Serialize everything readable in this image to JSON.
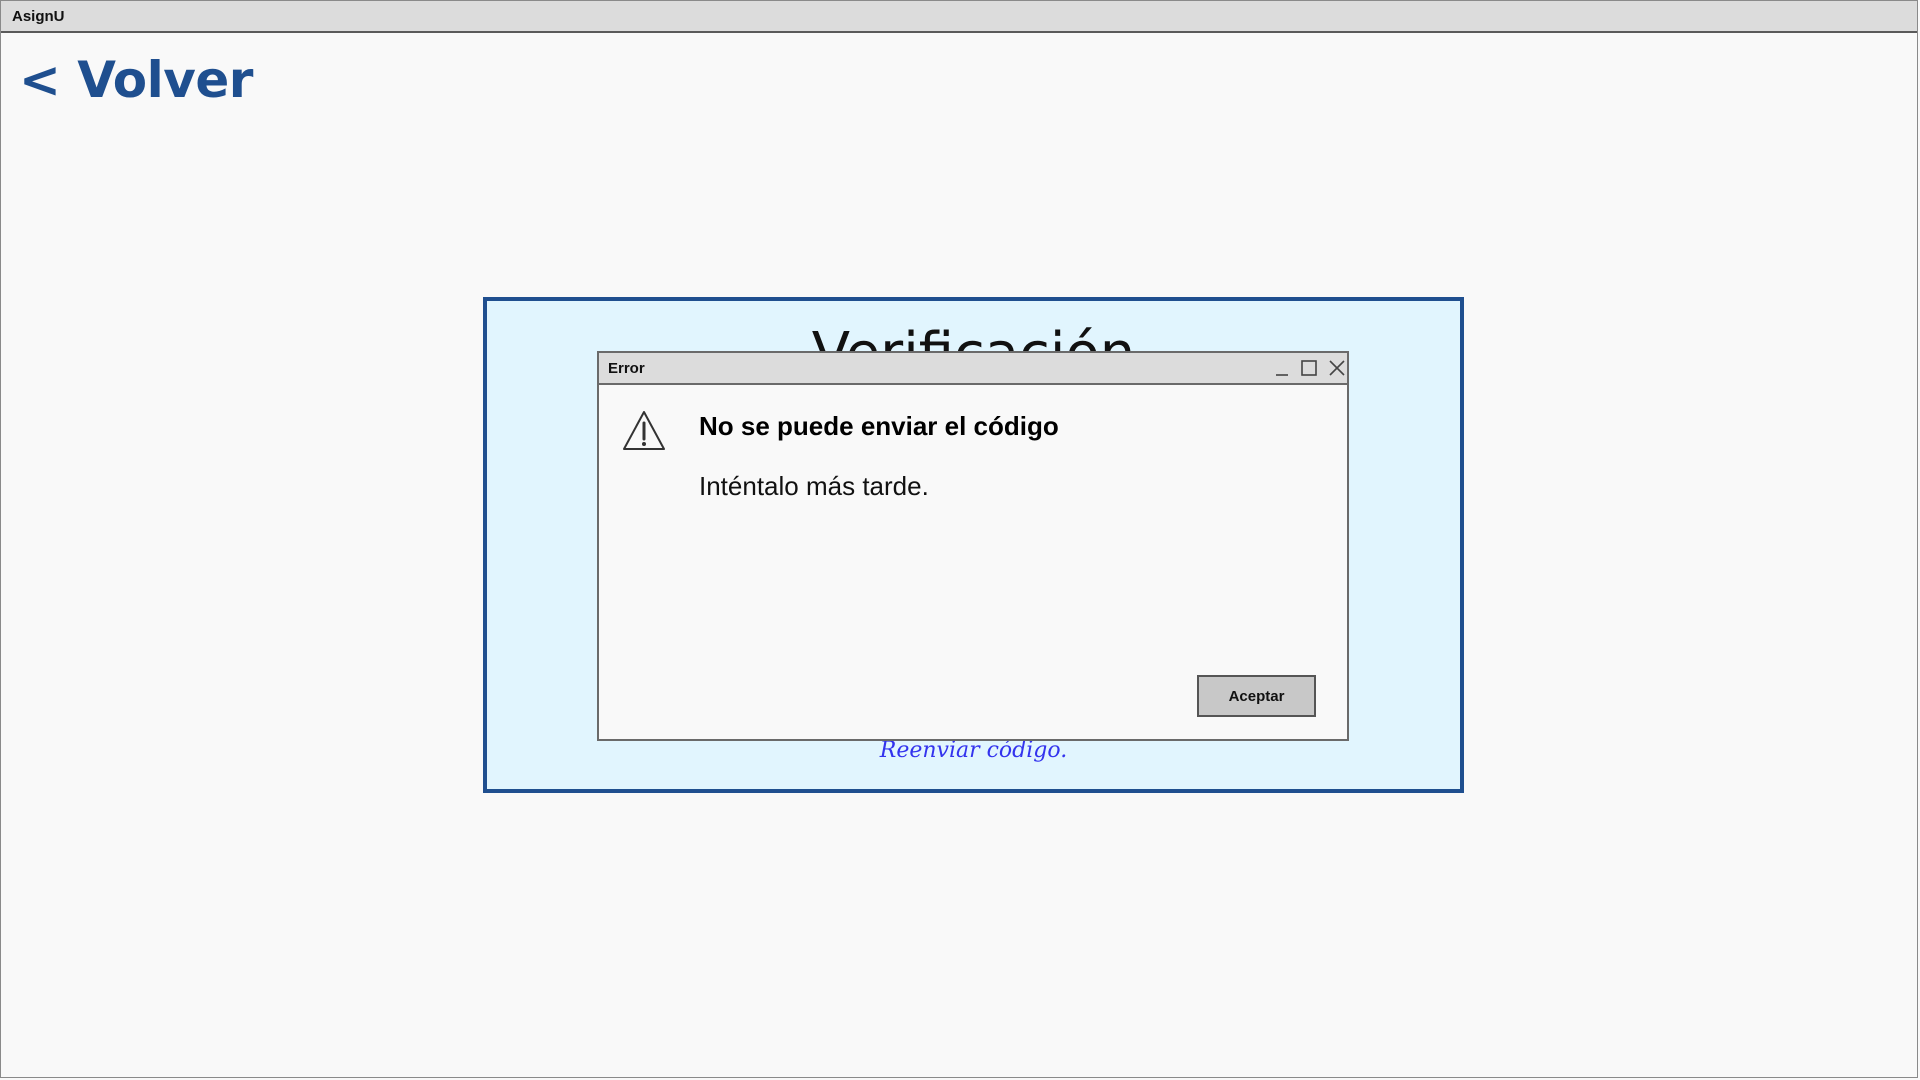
{
  "app": {
    "title": "AsignU"
  },
  "nav": {
    "back_label": "< Volver"
  },
  "verification_card": {
    "title": "Verificación",
    "resend_link": "Reenviar código."
  },
  "error_dialog": {
    "title": "Error",
    "heading": "No se puede enviar el código",
    "message": "Inténtalo más tarde.",
    "accept_label": "Aceptar",
    "icons": {
      "minimize": "minimize-icon",
      "maximize": "maximize-icon",
      "close": "close-icon",
      "warning": "warning-icon"
    }
  },
  "colors": {
    "accent": "#1f4f8f",
    "card_background": "#e1f5fe",
    "link": "#3333ee",
    "page_background": "#f9f9f9"
  }
}
